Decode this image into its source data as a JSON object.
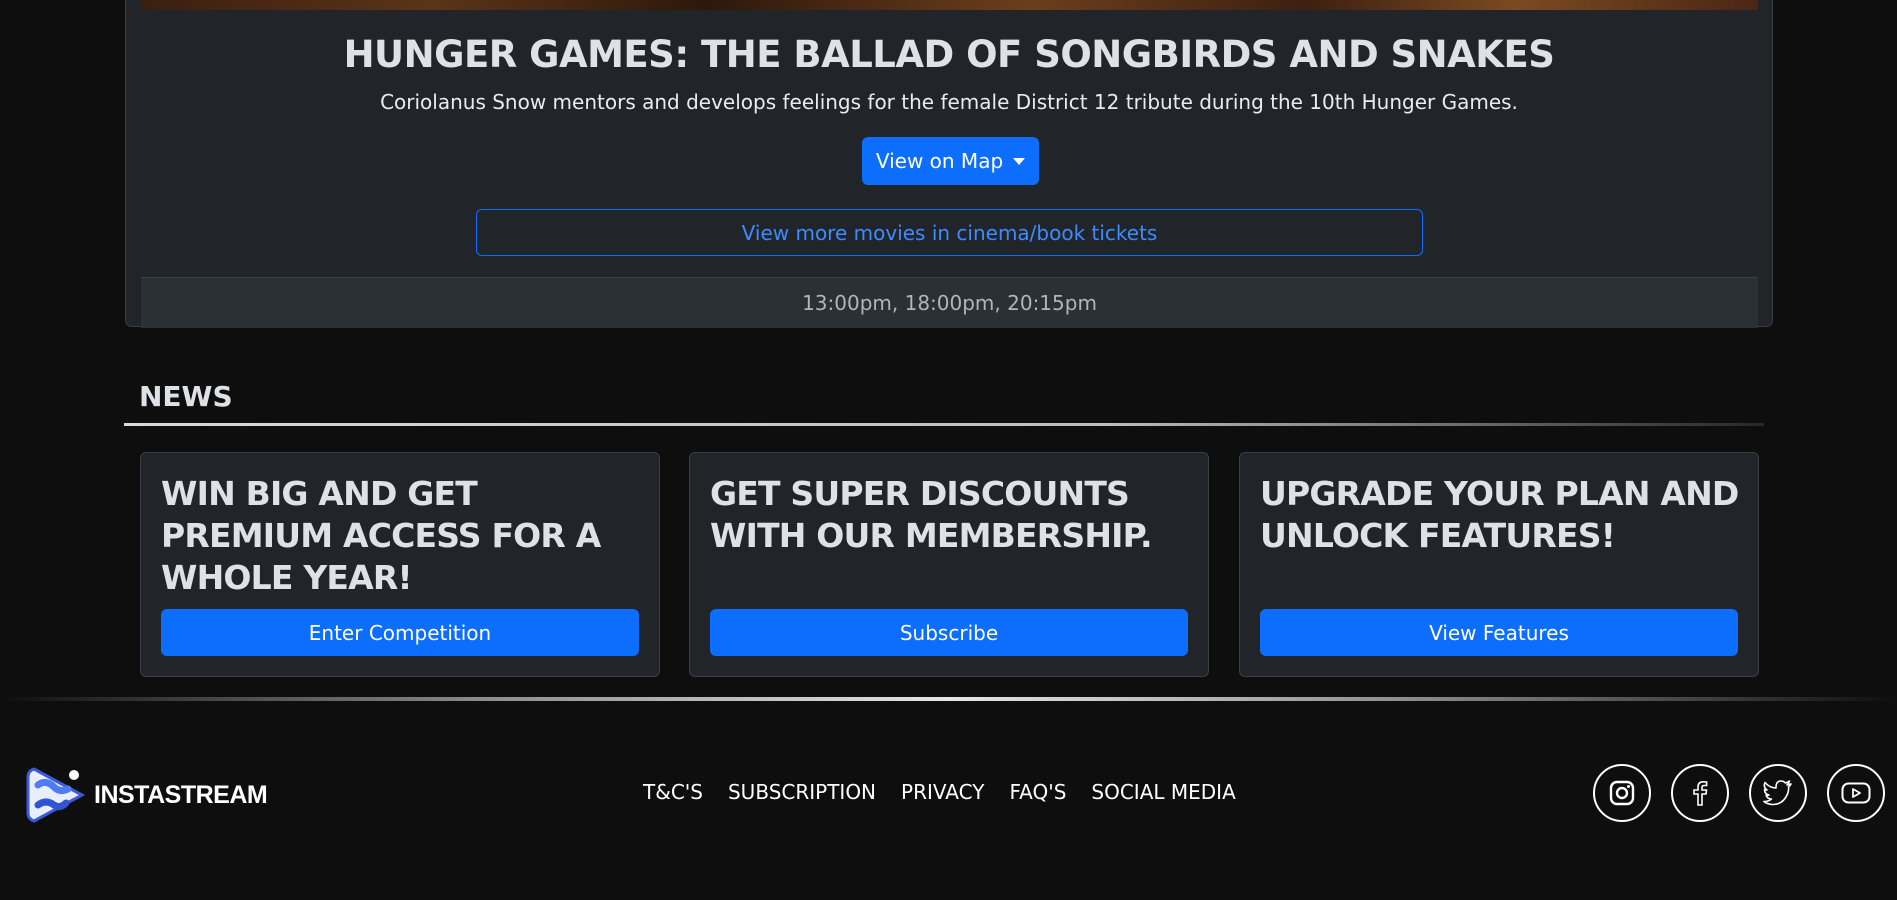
{
  "movie": {
    "title": "HUNGER GAMES: THE BALLAD OF SONGBIRDS AND SNAKES",
    "description": "Coriolanus Snow mentors and develops feelings for the female District 12 tribute during the 10th Hunger Games.",
    "map_button": "View on Map",
    "more_button": "View more movies in cinema/book tickets",
    "showtimes": "13:00pm, 18:00pm, 20:15pm"
  },
  "news": {
    "heading": "NEWS",
    "cards": [
      {
        "title": "WIN BIG AND GET PREMIUM ACCESS FOR A WHOLE YEAR!",
        "button": "Enter Competition"
      },
      {
        "title": "GET SUPER DISCOUNTS WITH OUR MEMBERSHIP.",
        "button": "Subscribe"
      },
      {
        "title": "UPGRADE YOUR PLAN AND UNLOCK FEATURES!",
        "button": "View Features"
      }
    ]
  },
  "footer": {
    "logo_text": "INSTASTREAM",
    "nav": [
      "T&C'S",
      "SUBSCRIPTION",
      "PRIVACY",
      "FAQ'S",
      "SOCIAL MEDIA"
    ],
    "social_icons": [
      "instagram-icon",
      "facebook-icon",
      "twitter-icon",
      "youtube-icon"
    ]
  },
  "colors": {
    "accent": "#0d6efd",
    "card_bg": "#212529",
    "page_bg": "#0e0e0f"
  }
}
